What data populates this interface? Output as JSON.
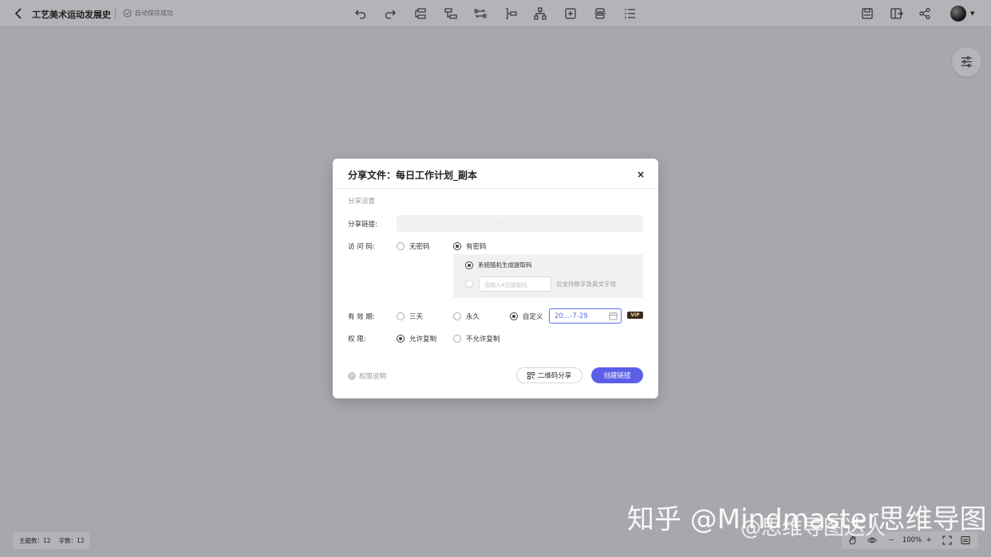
{
  "header": {
    "doc_title": "工艺美术运动发展史",
    "save_status": "自动保存成功",
    "toolbar_icons": [
      "undo-icon",
      "redo-icon",
      "insert-child-topic-icon",
      "insert-sibling-topic-icon",
      "relationship-icon",
      "summary-icon",
      "structure-icon",
      "insert-icon",
      "outline-icon",
      "list-icon"
    ],
    "right_icons": [
      "save-icon",
      "export-icon",
      "share-icon"
    ]
  },
  "dialog": {
    "title": "分享文件：每日工作计划_副本",
    "close": "×",
    "section_label": "分享设置",
    "link_label": "分享链接:",
    "link_value": "...",
    "access_label": "访 问 码:",
    "access_options": [
      "无密码",
      "有密码"
    ],
    "access_selected": "有密码",
    "code_options": [
      "系统随机生成提取码"
    ],
    "code_placeholder": "请输入4位提取码",
    "code_hint": "仅支持数字及英文字母",
    "validity_label": "有 效 期:",
    "validity_options": [
      "三天",
      "永久",
      "自定义"
    ],
    "validity_selected": "自定义",
    "date_value": "20…-7-29",
    "vip_badge": "VIP",
    "permission_label": "权    限:",
    "permission_options": [
      "允许复制",
      "不允许复制"
    ],
    "permission_selected": "允许复制",
    "permission_note": "权限说明",
    "qr_button": "二维码分享",
    "create_button": "创建链接"
  },
  "status_bar": {
    "topics": "主题数：12",
    "words": "字数：12"
  },
  "zoom": {
    "level": "100%",
    "minus": "−",
    "plus": "+"
  },
  "watermark": {
    "line1": "知乎 @Mindmaster思维导图",
    "line2": "@思维导图达人"
  },
  "colors": {
    "accent": "#5b5fe8",
    "date_border": "#5b6eea",
    "overlay_bg": "#a6a8ac"
  }
}
